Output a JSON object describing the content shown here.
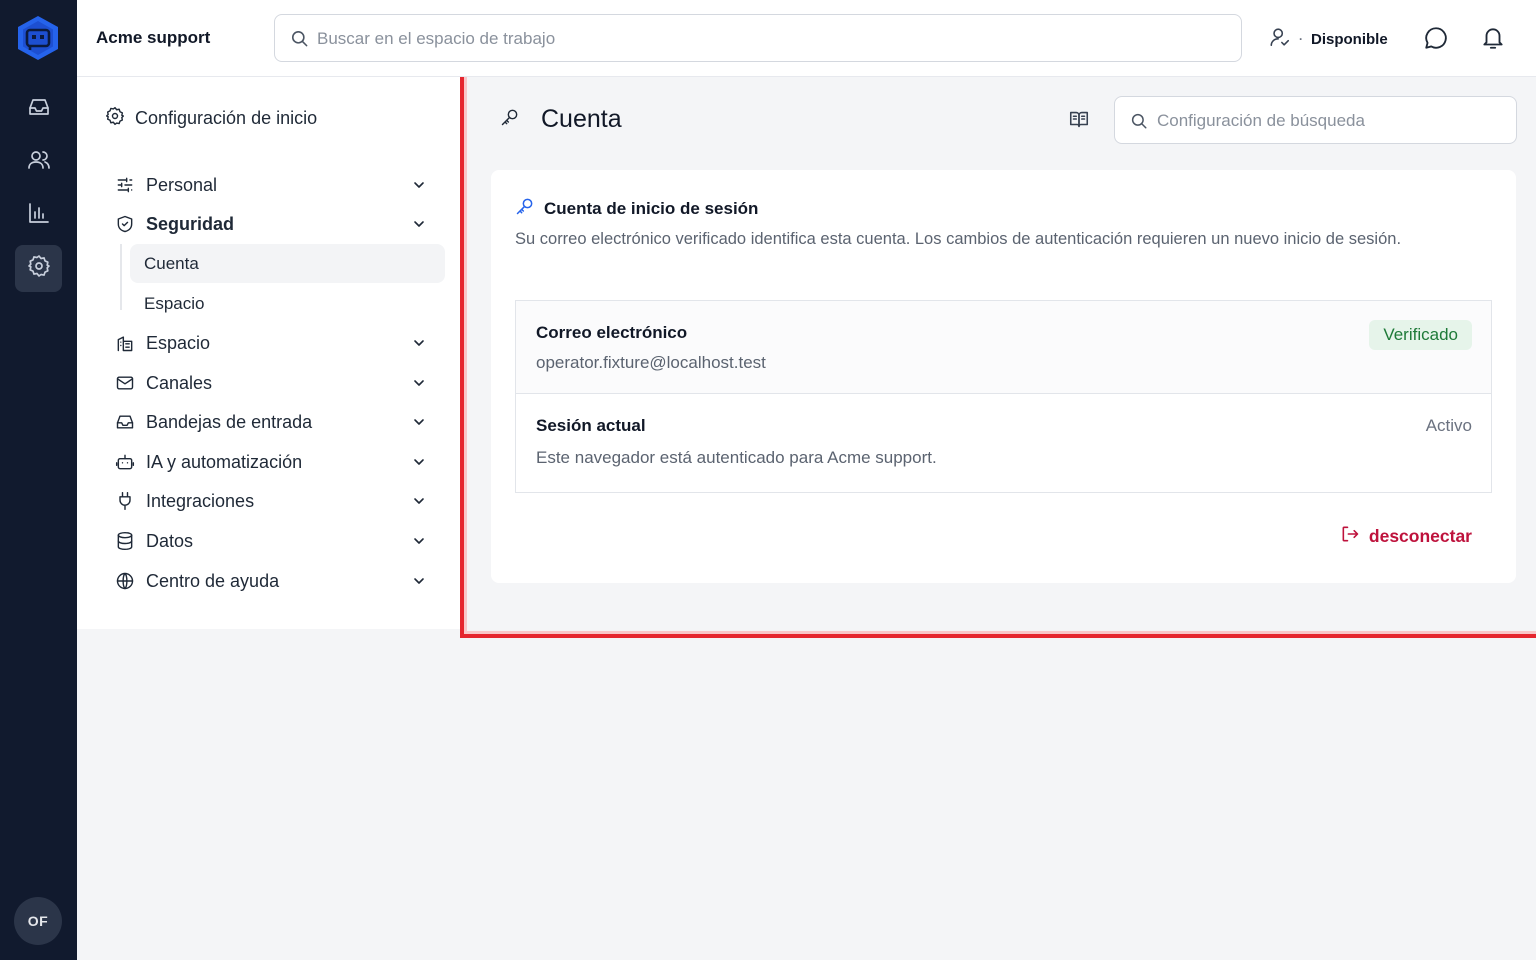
{
  "app": {
    "workspace_name": "Acme support",
    "user_initials": "OF",
    "brand_color": "#2563eb",
    "rail_icons": [
      "inbox-icon",
      "contacts-icon",
      "reports-icon",
      "settings-icon"
    ]
  },
  "header": {
    "search_placeholder": "Buscar en el espacio de trabajo",
    "availability_dot": "·",
    "availability_label": "Disponible"
  },
  "settings_nav": {
    "heading": "Configuración de inicio",
    "items": [
      {
        "label": "Personal",
        "icon": "sliders-icon"
      },
      {
        "label": "Seguridad",
        "icon": "shield-icon"
      },
      {
        "label": "Espacio",
        "icon": "building-icon"
      },
      {
        "label": "Canales",
        "icon": "mail-icon"
      },
      {
        "label": "Bandejas de entrada",
        "icon": "inbox-icon"
      },
      {
        "label": "IA y automatización",
        "icon": "bot-icon"
      },
      {
        "label": "Integraciones",
        "icon": "plug-icon"
      },
      {
        "label": "Datos",
        "icon": "database-icon"
      },
      {
        "label": "Centro de ayuda",
        "icon": "globe-icon"
      }
    ],
    "security_sub": [
      {
        "label": "Cuenta",
        "active": true
      },
      {
        "label": "Espacio",
        "active": false
      }
    ]
  },
  "page": {
    "title": "Cuenta",
    "search_placeholder": "Configuración de búsqueda"
  },
  "login_card": {
    "title": "Cuenta de inicio de sesión",
    "description": "Su correo electrónico verificado identifica esta cuenta. Los cambios de autenticación requieren un nuevo inicio de sesión.",
    "email_label": "Correo electrónico",
    "email_value": "operator.fixture@localhost.test",
    "email_badge": "Verificado",
    "session_label": "Sesión actual",
    "session_value": "Este navegador está autenticado para Acme support.",
    "session_status": "Activo",
    "logout_label": "desconectar"
  },
  "colors": {
    "rail_bg": "#111a2e",
    "highlight_border": "#e5262f",
    "verified_bg": "#e6f4ea",
    "verified_text": "#1e7a38",
    "logout_text": "#be123c"
  }
}
